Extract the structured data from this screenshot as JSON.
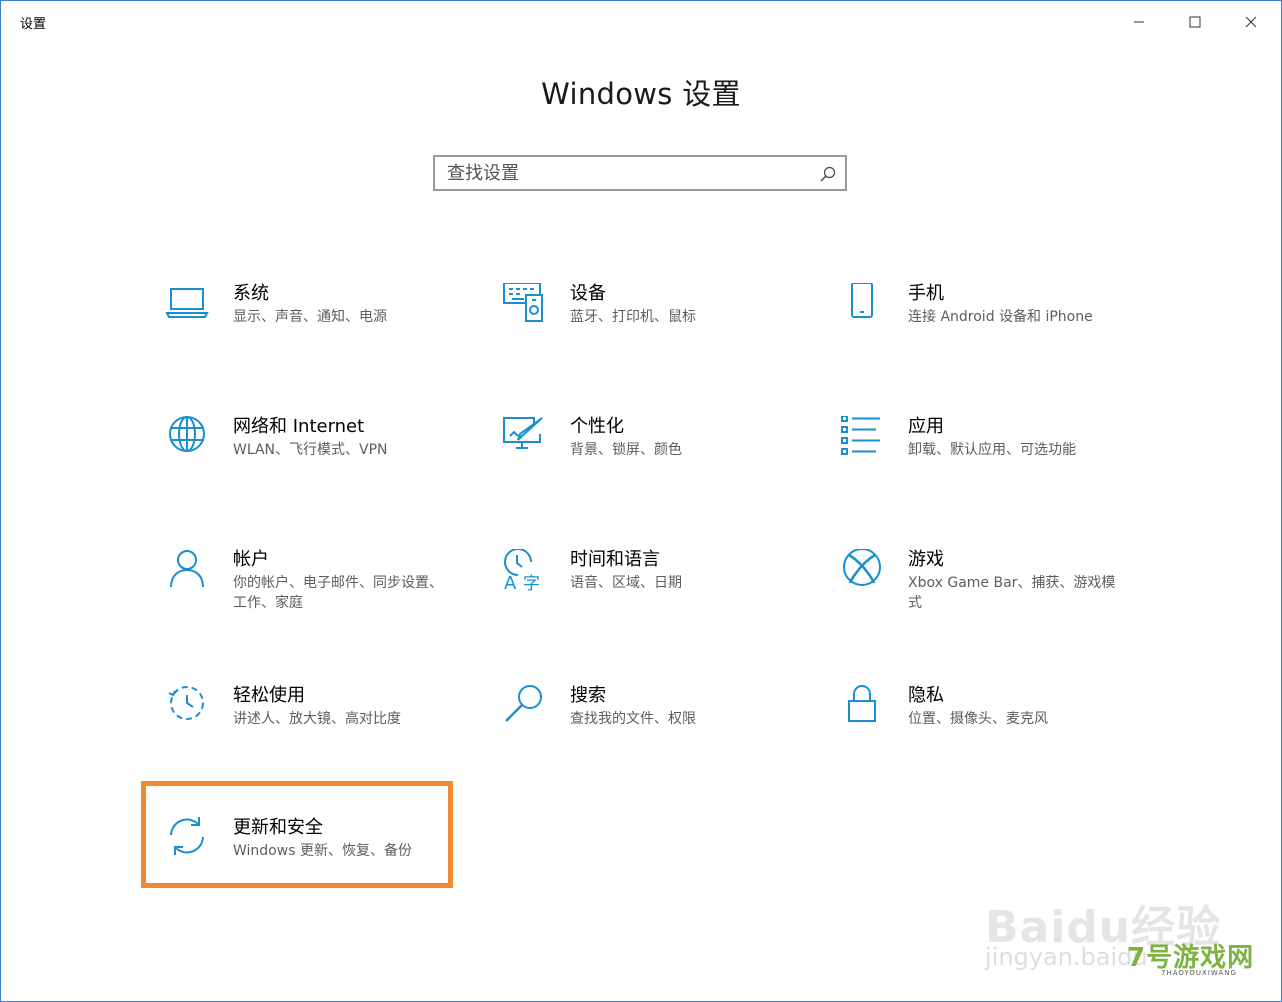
{
  "window": {
    "title": "设置",
    "minimize_label": "—",
    "maximize_label": "□",
    "close_label": "✕"
  },
  "header": {
    "title": "Windows 设置"
  },
  "search": {
    "placeholder": "查找设置",
    "icon": "search-icon"
  },
  "tiles": [
    {
      "title": "系统",
      "desc": "显示、声音、通知、电源",
      "icon": "laptop-icon"
    },
    {
      "title": "设备",
      "desc": "蓝牙、打印机、鼠标",
      "icon": "devices-icon"
    },
    {
      "title": "手机",
      "desc": "连接 Android 设备和 iPhone",
      "icon": "phone-icon"
    },
    {
      "title": "网络和 Internet",
      "desc": "WLAN、飞行模式、VPN",
      "icon": "globe-icon"
    },
    {
      "title": "个性化",
      "desc": "背景、锁屏、颜色",
      "icon": "personalization-icon"
    },
    {
      "title": "应用",
      "desc": "卸载、默认应用、可选功能",
      "icon": "apps-list-icon"
    },
    {
      "title": "帐户",
      "desc": "你的帐户、电子邮件、同步设置、工作、家庭",
      "icon": "person-icon"
    },
    {
      "title": "时间和语言",
      "desc": "语音、区域、日期",
      "icon": "time-language-icon"
    },
    {
      "title": "游戏",
      "desc": "Xbox Game Bar、捕获、游戏模式",
      "icon": "xbox-icon"
    },
    {
      "title": "轻松使用",
      "desc": "讲述人、放大镜、高对比度",
      "icon": "ease-of-access-icon"
    },
    {
      "title": "搜索",
      "desc": "查找我的文件、权限",
      "icon": "magnifier-icon"
    },
    {
      "title": "隐私",
      "desc": "位置、摄像头、麦克风",
      "icon": "lock-icon"
    },
    {
      "title": "更新和安全",
      "desc": "Windows 更新、恢复、备份",
      "icon": "sync-icon"
    }
  ],
  "watermark": {
    "baidu": "Baidu经验",
    "jingyan": "jingyan.baidu",
    "site": "7号游戏网",
    "site_sub": "7HAOYOUXIWANG"
  },
  "colors": {
    "accent": "#1a8fd0",
    "highlight": "#f28a30",
    "desc_text": "#5d5d5d"
  }
}
